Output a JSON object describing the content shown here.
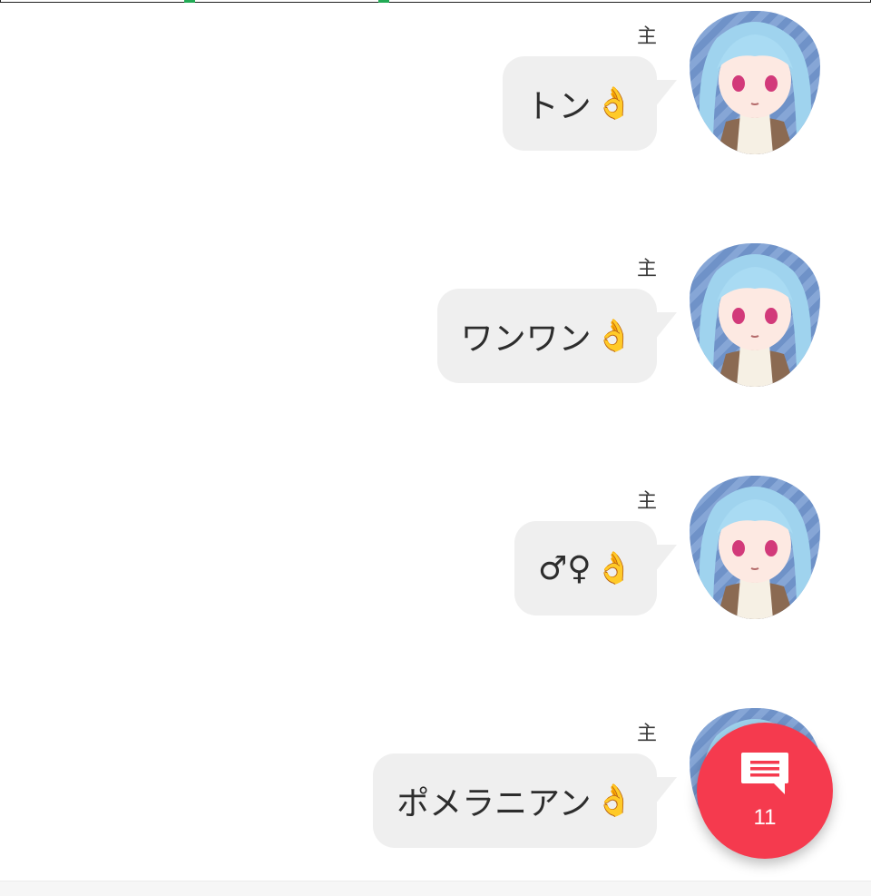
{
  "messages": [
    {
      "sender": "主",
      "text": "トン",
      "emoji": "👌"
    },
    {
      "sender": "主",
      "text": "ワンワン",
      "emoji": "👌"
    },
    {
      "sender": "主",
      "text": "♂♀",
      "emoji": "👌"
    },
    {
      "sender": "主",
      "text": "ポメラニアン",
      "emoji": "👌"
    }
  ],
  "fab": {
    "icon": "comment-icon",
    "count": "11"
  },
  "colors": {
    "bubble": "#efefef",
    "fab": "#f53a4e",
    "text": "#2d2d2d"
  }
}
